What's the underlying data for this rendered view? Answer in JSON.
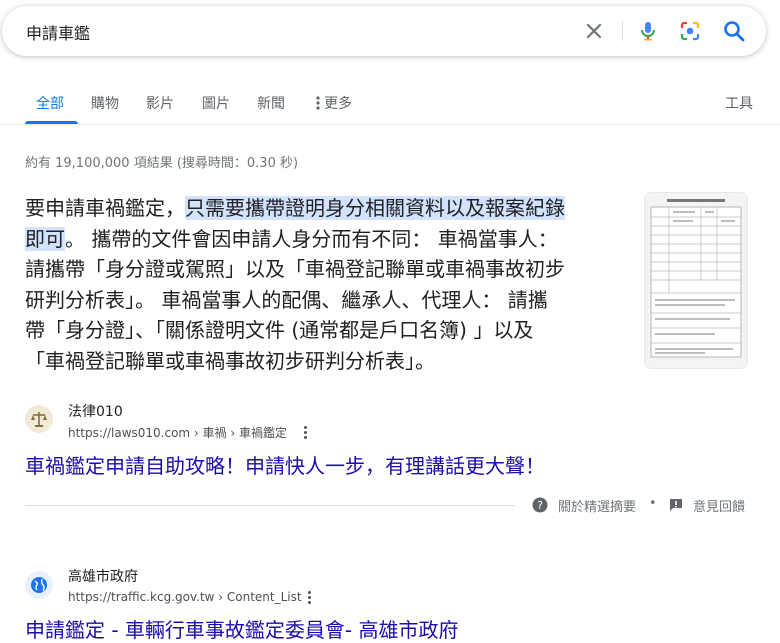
{
  "search": {
    "query": "申請車鑑"
  },
  "tabs": [
    {
      "label": "全部"
    },
    {
      "label": "購物"
    },
    {
      "label": "影片"
    },
    {
      "label": "圖片"
    },
    {
      "label": "新聞"
    },
    {
      "label": "更多"
    },
    {
      "label": "工具"
    }
  ],
  "stats": "約有 19,100,000 項結果 (搜尋時間：0.30 秒)",
  "featured": {
    "highlight": "只需要攜帶證明身分相關資料以及報案紀錄即可",
    "lines": [
      {
        "pre": "要申請車禍鑑定，",
        "hl": "只需要攜帶證明身分相關資料以及報案紀錄",
        "post": ""
      },
      {
        "pre": "",
        "hl": "即可",
        "post": "。 攜帶的文件會因申請人身分而有不同： 車禍當事人："
      },
      {
        "pre": "請攜帶「身分證或駕照」以及「車禍登記聯單或車禍事故初步",
        "hl": "",
        "post": ""
      },
      {
        "pre": "研判分析表」。 車禍當事人的配偶、繼承人、代理人： 請攜",
        "hl": "",
        "post": ""
      },
      {
        "pre": "帶「身分證」、「關係證明文件 (通常都是戶口名簿) 」以及",
        "hl": "",
        "post": ""
      },
      {
        "pre": "「車禍登記聯單或車禍事故初步研判分析表」。",
        "hl": "",
        "post": ""
      }
    ]
  },
  "results": [
    {
      "site": "法律010",
      "url": "https://laws010.com › 車禍 › 車禍鑑定",
      "title": "車禍鑑定申請自助攻略！申請快人一步，有理講話更大聲！"
    },
    {
      "site": "高雄市政府",
      "url": "https://traffic.kcg.gov.tw › Content_List",
      "title": "申請鑑定 - 車輛行車事故鑑定委員會- 高雄市政府"
    }
  ],
  "footer": {
    "about": "關於精選摘要",
    "dot": "•",
    "feedback": "意見回饋"
  },
  "colors": {
    "link": "#1a0dab",
    "accent": "#1a73e8",
    "highlight": "#d3e3fd"
  }
}
